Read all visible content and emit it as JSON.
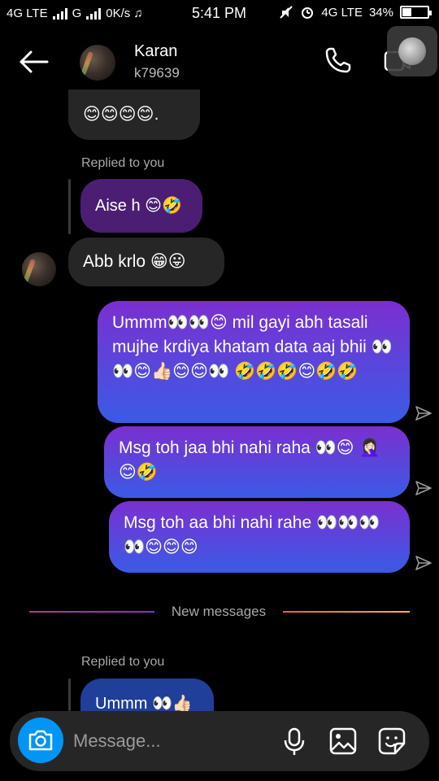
{
  "status_bar": {
    "left": "4G LTE",
    "left2": "G",
    "speed": "0K/s ♫",
    "time": "5:41 PM",
    "right_net": "4G LTE",
    "battery": "34%",
    "battery_fraction": 0.34
  },
  "header": {
    "name": "Karan",
    "username": "k79639"
  },
  "messages": {
    "m1": "😊😊😊😊.",
    "reply1_label": "Replied to you",
    "reply1_text": "Aise h 😊🤣",
    "m2": "Abb krlo 😁😛",
    "out1": "Ummm👀👀😊 mil gayi abh tasali mujhe krdiya khatam data aaj bhii 👀👀😊👍🏻😊😊👀 🤣🤣🤣😊🤣🤣",
    "out2": "Msg toh jaa bhi nahi raha 👀😊 🤦🏻‍♀️😊🤣",
    "out3": "Msg toh aa bhi nahi rahe 👀👀👀 👀😊😊😊",
    "divider": "New messages",
    "reply2_label": "Replied to you",
    "reply2_text": "Ummm 👀👍🏻"
  },
  "composer": {
    "placeholder": "Message..."
  },
  "colors": {
    "accent_blue": "#0095f6",
    "out_gradient_top": "#7b2fd0",
    "out_gradient_bottom": "#3a5be6"
  }
}
